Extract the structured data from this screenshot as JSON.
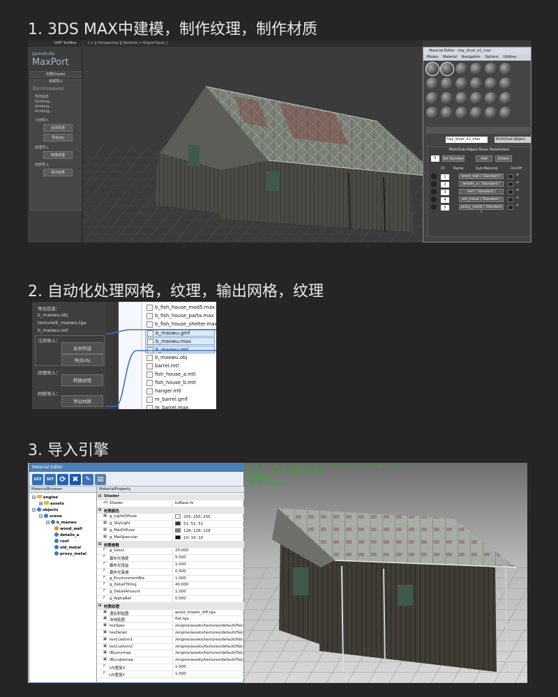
{
  "sections": {
    "s1_title": "1. 3DS MAX中建模，制作纹理，制作材质",
    "s2_title": "2. 自动化处理网格，纹理，输出网格，纹理",
    "s3_title": "3. 导入引擎"
  },
  "s1": {
    "maxport": {
      "toolbox_tab": "GMF ToolBox",
      "brand_small": "gameKnife",
      "brand_large": "MaxPort",
      "shader_row": "材质Shader",
      "import_header": "资源导入",
      "environment": "Environment",
      "export_info_label": "导出信息",
      "thinking": [
        "thinking...",
        "thinking...",
        "thinking..."
      ],
      "geometry_label": "几何导入",
      "merge_button": "合并所选",
      "export_obj_button": "导出obj",
      "texture_label": "纹理导入",
      "convert_texture_button": "转换纹理",
      "material_label": "材质导入",
      "export_material_button": "导出材质"
    },
    "viewport_label": "[ + ][ Perspective ][ Realistic + Edged Faces ]",
    "material_editor": {
      "title": "Material Editor - hay_dryer_e1_mao",
      "menu": [
        "Modes",
        "Material",
        "Navigation",
        "Options",
        "Utilities"
      ],
      "material_name": "hay_dryer_e1_mao",
      "material_type": "Multi/Sub-Object",
      "params_title": "Multi/Sub-Object Basic Parameters",
      "count": "5",
      "set_number": "Set Number",
      "add": "Add",
      "delete": "Delete",
      "col_id": "ID",
      "col_name": "Name",
      "col_sub": "Sub-Material",
      "col_onoff": "On/Off",
      "rows": [
        {
          "id": "1",
          "sub": "wood_wall ( Standard )"
        },
        {
          "id": "2",
          "sub": "details_a ( Standard )"
        },
        {
          "id": "3",
          "sub": "roof ( Standard )"
        },
        {
          "id": "4",
          "sub": "old_metal ( Standard )"
        },
        {
          "id": "5",
          "sub": "proxy_metal ( Standard )"
        }
      ]
    }
  },
  "s2": {
    "export_info": "导出信息：",
    "files_left": [
      "b_maowu.obj",
      "texture/b_maowu.tga",
      "b_maowu.mtl"
    ],
    "geometry_label": "几何导入：",
    "merge_button": "合并所选",
    "export_obj_button": "导出obj",
    "texture_label": "纹理导入：",
    "convert_texture_button": "转换纹理",
    "material_label": "材质导入：",
    "export_material_button": "导出材质",
    "file_list": [
      "b_fish_house_mod5.max",
      "b_fish_house_parta.max",
      "b_fish_house_shelter.max",
      "b_maowu.gmf",
      "b_maowu.max",
      "b_maowu.mtl",
      "b_maowu.obj",
      "barrel.mtl",
      "fish_house_a.mtl",
      "fish_house_b.mtl",
      "hanger.mtl",
      "m_barrel.gmf",
      "m_barrel.max"
    ]
  },
  "s3": {
    "editor_title": "Material Editor",
    "toolbar": [
      "GET",
      "SET"
    ],
    "browser_header": "MaterialBrowser",
    "property_header": "MaterialProperty",
    "tree": [
      "engine",
      "assets",
      "objects",
      "scene",
      "b_maowu",
      "wood_wall",
      "details_a",
      "roof",
      "old_metal",
      "proxy_metal"
    ],
    "props": [
      {
        "sec": true,
        "k": "Shader"
      },
      {
        "ic": "ab",
        "k": "Shader",
        "v": "ksBase.fx"
      },
      {
        "sec": true,
        "k": "材质颜色"
      },
      {
        "ic": "▦",
        "k": "g_LightDiffuse",
        "v": "255; 255; 255",
        "sw": "#ffffff"
      },
      {
        "ic": "▦",
        "k": "g_SkyLight",
        "v": "51; 51; 51",
        "sw": "#333333"
      },
      {
        "ic": "▦",
        "k": "g_MatDiffuse",
        "v": "128; 128; 128",
        "sw": "#808080"
      },
      {
        "ic": "▦",
        "k": "g_MatSpecular",
        "v": "10; 10; 10",
        "sw": "#0a0a0a"
      },
      {
        "sec": true,
        "k": "材质参数"
      },
      {
        "ic": "F",
        "k": "g_Gloss",
        "v": "25.000"
      },
      {
        "ic": "F",
        "k": "幕布光强度",
        "v": "5.000"
      },
      {
        "ic": "F",
        "k": "幕布光增益",
        "v": "1.000"
      },
      {
        "ic": "F",
        "k": "幕布光衰减",
        "v": "0.500"
      },
      {
        "ic": "F",
        "k": "g_EnvironmentBia",
        "v": "1.000"
      },
      {
        "ic": "F",
        "k": "g_DetailTilling",
        "v": "40.000"
      },
      {
        "ic": "F",
        "k": "g_DetailAmount",
        "v": "1.000"
      },
      {
        "ic": "F",
        "k": "g_AlphaRef",
        "v": "0.000"
      },
      {
        "sec": true,
        "k": "材质纹理"
      },
      {
        "ic": "▣",
        "k": "漫反射贴图",
        "v": "wood_sheets_diff.tga"
      },
      {
        "ic": "▣",
        "k": "法线贴图",
        "v": "flat.tga"
      },
      {
        "ic": "▣",
        "k": "texSpec",
        "v": "/engine/assets/textures/default/flat.tga"
      },
      {
        "ic": "▣",
        "k": "texDetail",
        "v": "/engine/assets/textures/default/flat.tga"
      },
      {
        "ic": "▣",
        "k": "texCustom1",
        "v": "/engine/assets/textures/default/flat.tga"
      },
      {
        "ic": "▣",
        "k": "texCustom2",
        "v": "/engine/assets/textures/default/flat.tga"
      },
      {
        "ic": "▣",
        "k": "IBLenvmap",
        "v": "/engine/assets/textures/default/flat.tga"
      },
      {
        "ic": "▣",
        "k": "IBLcubemap",
        "v": "/engine/assets/textures/default/flat.tga"
      },
      {
        "ic": "F",
        "k": "UV重复X",
        "v": "1.000"
      },
      {
        "ic": "F",
        "k": "UV重复Y",
        "v": "1.000"
      }
    ],
    "render_stats": "FPS 60.0 | Cam: X=-9.8 Y=15.3 Z=7.7 | Tri:0.03 | DP:1000.00 | Fov:45.0\n0 ms GMT | 3.28 ms SCENE | 0.02 ms\n| 1280x720\n| pk/15 | MSAA x4"
  }
}
